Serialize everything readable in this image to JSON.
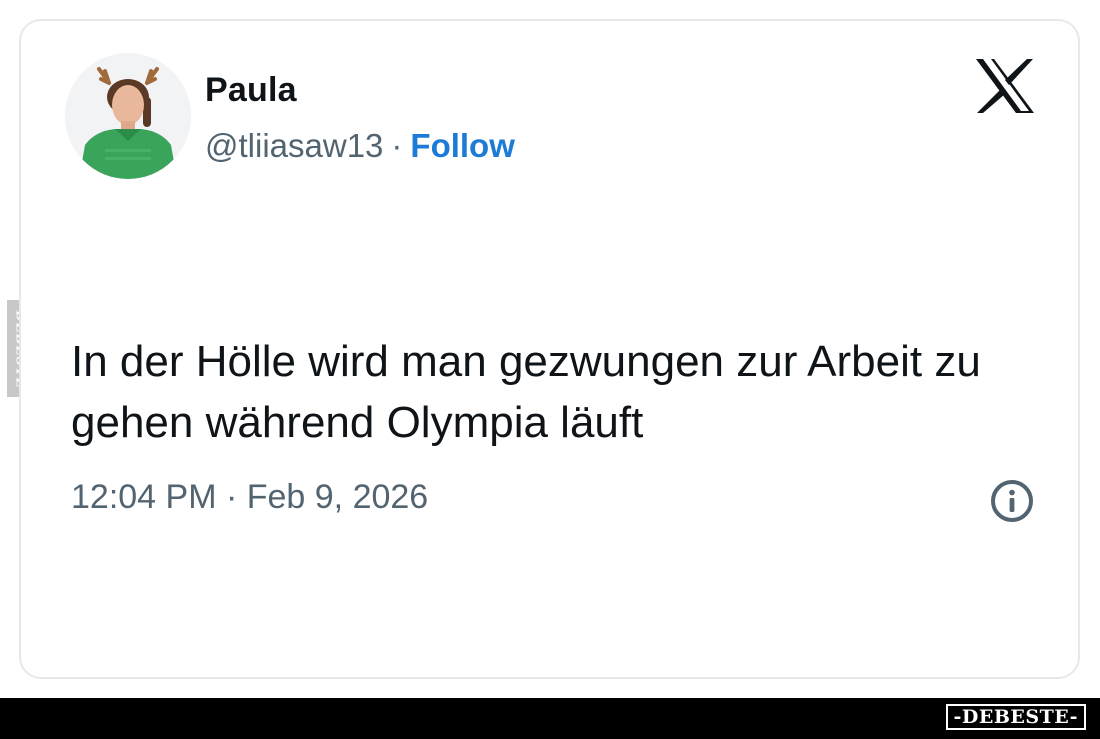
{
  "tweet": {
    "author_name": "Paula",
    "handle": "@tliiasaw13",
    "separator": "·",
    "follow_label": "Follow",
    "text": "In der Hölle wird man gezwungen zur Arbeit zu gehen während Olympia läuft",
    "timestamp": "12:04 PM · Feb 9, 2026",
    "platform_icon": "x-logo-icon",
    "info_icon": "info-icon"
  },
  "watermark": {
    "side_label": "DEBESTE",
    "brand_label": "-DEBESTE-"
  },
  "colors": {
    "text_primary": "#0f1419",
    "text_secondary": "#536471",
    "follow_blue": "#1d7bd8",
    "card_border": "#e6e9ec",
    "bottom_bar": "#000000"
  }
}
